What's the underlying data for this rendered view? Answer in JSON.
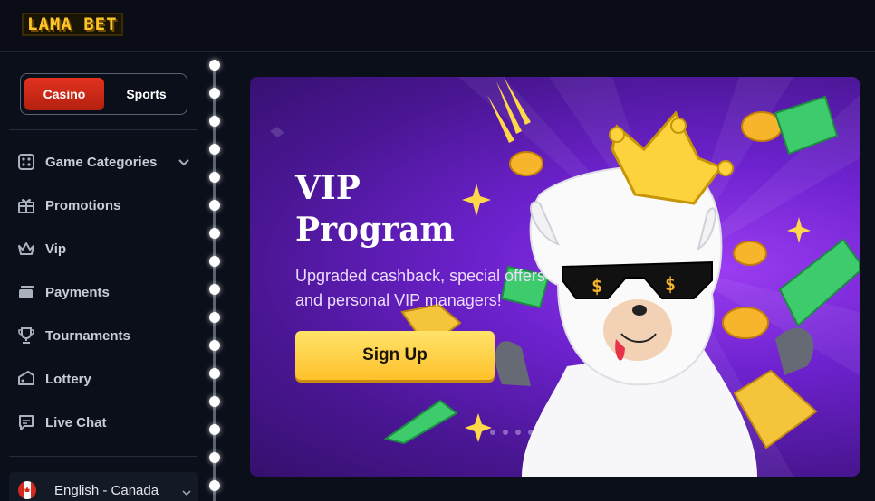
{
  "header": {
    "logo_text": "LAMA BET"
  },
  "sidebar": {
    "toggle": {
      "casino_label": "Casino",
      "sports_label": "Sports"
    },
    "items": [
      {
        "label": "Game Categories",
        "icon": "dice-icon",
        "expandable": true
      },
      {
        "label": "Promotions",
        "icon": "gift-icon"
      },
      {
        "label": "Vip",
        "icon": "crown-icon"
      },
      {
        "label": "Payments",
        "icon": "cards-icon"
      },
      {
        "label": "Tournaments",
        "icon": "trophy-icon"
      },
      {
        "label": "Lottery",
        "icon": "ticket-icon"
      },
      {
        "label": "Live Chat",
        "icon": "chat-icon"
      }
    ],
    "language": {
      "label": "English - Canada",
      "flag": "canada-flag-icon"
    }
  },
  "banner": {
    "title_line1": "VIP",
    "title_line2": "Program",
    "subtitle": "Upgraded cashback, special offers and personal VIP managers!",
    "cta_label": "Sign Up",
    "slides": 4
  },
  "colors": {
    "accent_red": "#d42a17",
    "cta_yellow": "#fdd03f",
    "banner_purple": "#6e22cf",
    "logo_yellow": "#ffc629"
  }
}
